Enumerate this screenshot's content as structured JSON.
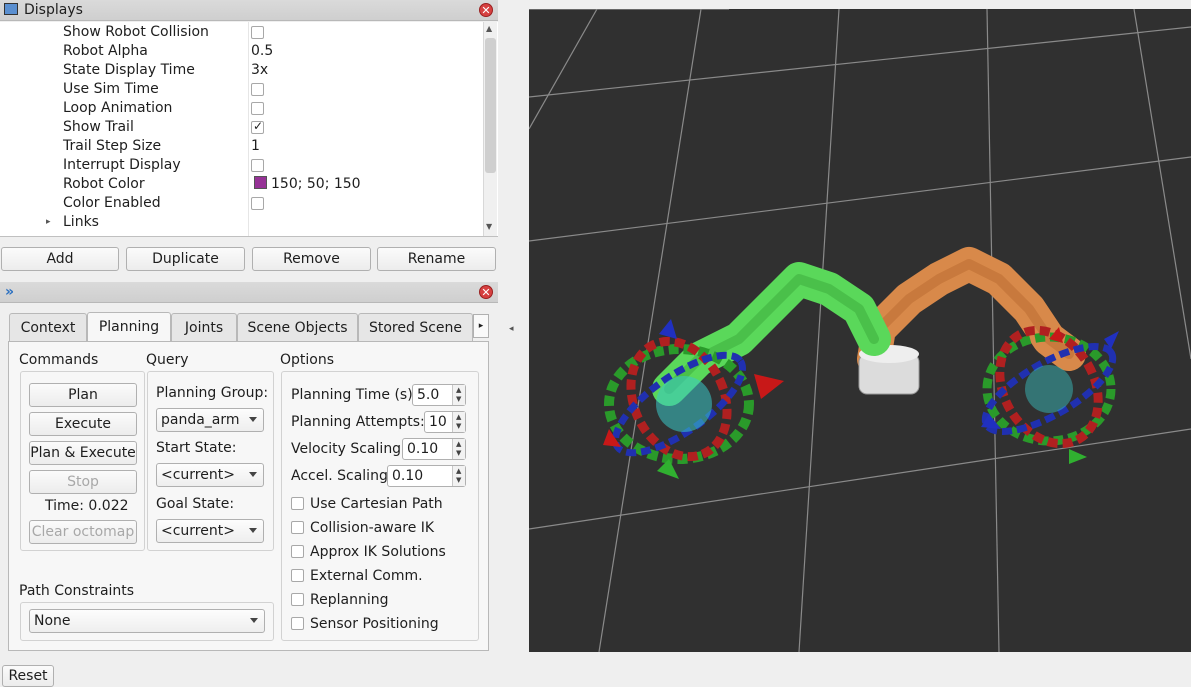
{
  "displays": {
    "title": "Displays",
    "properties": [
      {
        "name": "Show Robot Collision",
        "value": "",
        "kind": "checkbox",
        "checked": false
      },
      {
        "name": "Robot Alpha",
        "value": "0.5",
        "kind": "text"
      },
      {
        "name": "State Display Time",
        "value": "3x",
        "kind": "text"
      },
      {
        "name": "Use Sim Time",
        "value": "",
        "kind": "checkbox",
        "checked": false
      },
      {
        "name": "Loop Animation",
        "value": "",
        "kind": "checkbox",
        "checked": false
      },
      {
        "name": "Show Trail",
        "value": "",
        "kind": "checkbox",
        "checked": true
      },
      {
        "name": "Trail Step Size",
        "value": "1",
        "kind": "text"
      },
      {
        "name": "Interrupt Display",
        "value": "",
        "kind": "checkbox",
        "checked": false
      },
      {
        "name": "Robot Color",
        "value": "150; 50; 150",
        "kind": "color",
        "swatch": "#963296"
      },
      {
        "name": "Color Enabled",
        "value": "",
        "kind": "checkbox",
        "checked": false
      },
      {
        "name": "Links",
        "value": "",
        "kind": "expander"
      }
    ],
    "buttons": {
      "add": "Add",
      "duplicate": "Duplicate",
      "remove": "Remove",
      "rename": "Rename"
    }
  },
  "motion_panel": {
    "tabs": [
      "Context",
      "Planning",
      "Joints",
      "Scene Objects",
      "Stored Scene"
    ],
    "active_tab": "Planning",
    "commands": {
      "heading": "Commands",
      "plan": "Plan",
      "execute": "Execute",
      "plan_execute": "Plan & Execute",
      "stop": "Stop",
      "time_label": "Time: 0.022",
      "clear_octomap": "Clear octomap"
    },
    "query": {
      "heading": "Query",
      "planning_group_label": "Planning Group:",
      "planning_group_value": "panda_arm",
      "start_state_label": "Start State:",
      "start_state_value": "<current>",
      "goal_state_label": "Goal State:",
      "goal_state_value": "<current>"
    },
    "options": {
      "heading": "Options",
      "planning_time_label": "Planning Time (s):",
      "planning_time_value": "5.0",
      "planning_attempts_label": "Planning Attempts:",
      "planning_attempts_value": "10",
      "velocity_label": "Velocity Scaling:",
      "velocity_value": "0.10",
      "accel_label": "Accel. Scaling:",
      "accel_value": "0.10",
      "checkboxes": [
        "Use Cartesian Path",
        "Collision-aware IK",
        "Approx IK Solutions",
        "External Comm.",
        "Replanning",
        "Sensor Positioning"
      ]
    },
    "path_constraints": {
      "heading": "Path Constraints",
      "value": "None"
    },
    "reset": "Reset"
  },
  "colors": {
    "viewport_bg": "#303030",
    "grid": "#8a8a8a",
    "goal_arm": "#5ad85a",
    "current_arm": "#d8894a"
  }
}
